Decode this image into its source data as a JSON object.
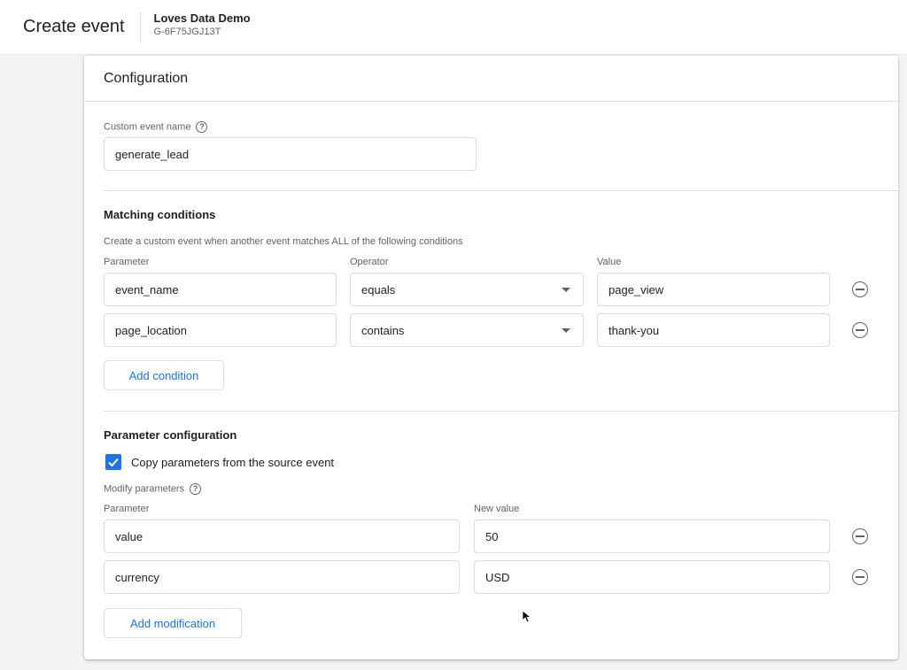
{
  "header": {
    "title": "Create event",
    "property_name": "Loves Data Demo",
    "property_id": "G-6F75JGJ13T"
  },
  "card": {
    "title": "Configuration",
    "custom_event": {
      "label": "Custom event name",
      "help_icon": "?",
      "value": "generate_lead"
    },
    "matching": {
      "title": "Matching conditions",
      "description": "Create a custom event when another event matches ALL of the following conditions",
      "headers": {
        "parameter": "Parameter",
        "operator": "Operator",
        "value": "Value"
      },
      "rows": [
        {
          "parameter": "event_name",
          "operator": "equals",
          "value": "page_view"
        },
        {
          "parameter": "page_location",
          "operator": "contains",
          "value": "thank-you"
        }
      ],
      "add_button": "Add condition"
    },
    "param_config": {
      "title": "Parameter configuration",
      "copy_label": "Copy parameters from the source event",
      "copy_checked": true,
      "modify_label": "Modify parameters",
      "help_icon": "?",
      "headers": {
        "parameter": "Parameter",
        "new_value": "New value"
      },
      "rows": [
        {
          "parameter": "value",
          "new_value": "50"
        },
        {
          "parameter": "currency",
          "new_value": "USD"
        }
      ],
      "add_button": "Add modification"
    }
  },
  "colors": {
    "accent": "#1a73e8",
    "text": "#202124",
    "muted": "#5f6368",
    "border": "#dadce0"
  },
  "icons": {
    "help": "help-circle-icon",
    "remove": "remove-circle-icon",
    "dropdown": "caret-down-icon",
    "check": "check-icon",
    "cursor": "mouse-pointer-icon"
  }
}
